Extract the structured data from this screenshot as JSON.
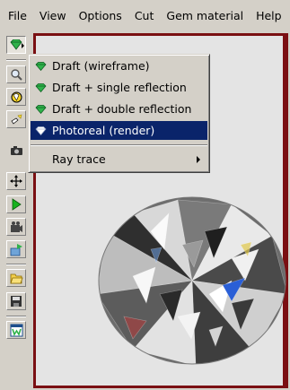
{
  "menubar": {
    "items": [
      "File",
      "View",
      "Options",
      "Cut",
      "Gem material",
      "Help"
    ]
  },
  "render_menu": {
    "items": [
      {
        "label": "Draft (wireframe)",
        "icon": "green-gem-icon"
      },
      {
        "label": "Draft + single reflection",
        "icon": "green-gem-icon"
      },
      {
        "label": "Draft + double reflection",
        "icon": "green-gem-icon"
      },
      {
        "label": "Photoreal (render)",
        "icon": "white-gem-icon",
        "selected": true
      }
    ],
    "submenu": {
      "label": "Ray trace",
      "has_arrow": true
    }
  },
  "toolbar": {
    "tools": [
      "render-mode-icon",
      "magnify-icon",
      "rotate-icon",
      "light-icon",
      "camera-icon",
      "move-icon",
      "play-icon",
      "movie-icon",
      "export-icon",
      "open-icon",
      "save-icon",
      "window-icon"
    ]
  },
  "colors": {
    "selection": "#0a246a",
    "canvas_frame": "#7a0f12",
    "canvas_bg": "#e4e4e4",
    "chrome": "#d4d0c8"
  }
}
